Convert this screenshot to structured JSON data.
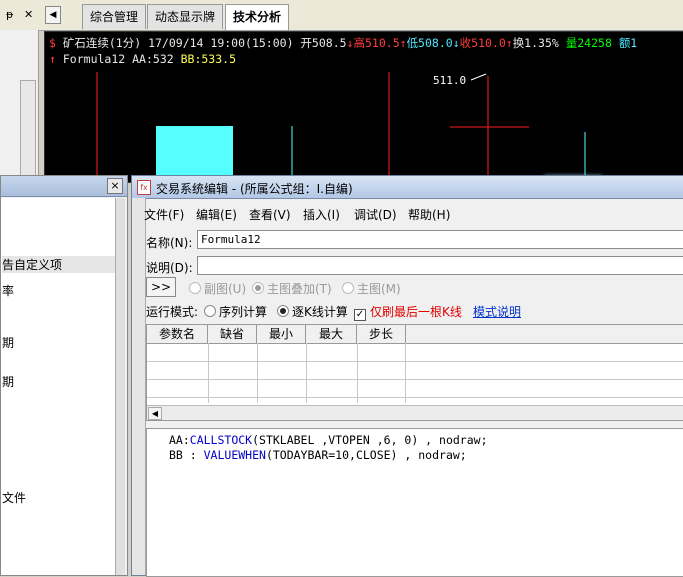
{
  "tabs": {
    "pin_icon": "pin-icon",
    "close_glyph": "✕",
    "nav_left": "◀",
    "items": [
      {
        "label": "综合管理",
        "active": false
      },
      {
        "label": "动态显示牌",
        "active": false
      },
      {
        "label": "技术分析",
        "active": true
      }
    ]
  },
  "chart": {
    "line1": {
      "marker": "$",
      "symbol": "矿石连续(1分)",
      "datetime": "17/09/14 19:00(15:00)",
      "open_label": "开508.5",
      "high_label": "高510.5",
      "low_label": "低508.0",
      "close_label": "收510.0",
      "turnover_label": "换1.35%",
      "volume_label": "量24258",
      "amount_label": "额1"
    },
    "line2": {
      "formula": "Formula12",
      "aa": "AA:532",
      "bb": "BB:533.5"
    },
    "price_annotation": "511.0",
    "colors": {
      "up": "#ff3b3b",
      "down": "#4fe8ff",
      "yellow": "#ffff54",
      "volume": "#00ff00"
    }
  },
  "side_panel": {
    "close_glyph": "×",
    "items": [
      "告自定义项",
      "率",
      "期",
      "期",
      "文件"
    ]
  },
  "editor": {
    "title": "交易系统编辑 - (所属公式组：I.自编)",
    "menu": [
      "文件(F)",
      "编辑(E)",
      "查看(V)",
      "插入(I)",
      "调试(D)",
      "帮助(H)"
    ],
    "name_label": "名称(N):",
    "name_value": "Formula12",
    "desc_label": "说明(D):",
    "desc_value": "",
    "expand_label": ">>",
    "chart_modes": [
      "副图(U)",
      "主图叠加(T)",
      "主图(M)"
    ],
    "run_mode_label": "运行模式:",
    "run_modes": [
      "序列计算",
      "逐K线计算"
    ],
    "refresh_last_label": "仅刷最后一根K线",
    "mode_help_link": "模式说明",
    "param_columns": [
      "参数名",
      "缺省",
      "最小",
      "最大",
      "步长"
    ],
    "code": {
      "line1": {
        "var": "AA:",
        "func": "CALLSTOCK",
        "args": "(STKLABEL ,VTOPEN ,6, 0) , nodraw;"
      },
      "line2": {
        "var": "BB : ",
        "func": "VALUEWHEN",
        "args": "(TODAYBAR=10,CLOSE) , nodraw;"
      }
    }
  }
}
